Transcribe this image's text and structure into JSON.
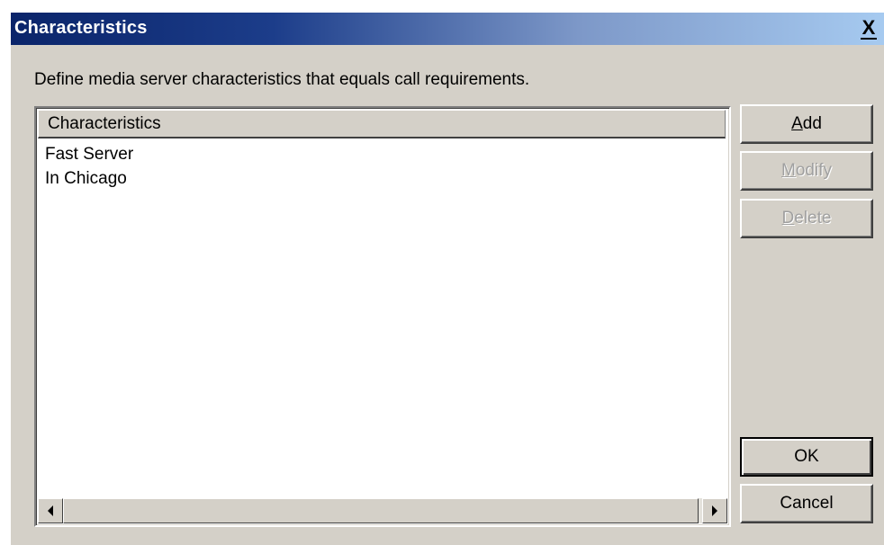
{
  "window": {
    "title": "Characteristics",
    "close_label": "X"
  },
  "description": "Define media server characteristics that equals call requirements.",
  "list": {
    "column_header": "Characteristics",
    "items": [
      "Fast Server",
      "In Chicago"
    ]
  },
  "buttons": {
    "add": {
      "accel": "A",
      "rest": "dd",
      "enabled": true
    },
    "modify": {
      "accel": "M",
      "rest": "odify",
      "enabled": false
    },
    "delete": {
      "accel": "D",
      "rest": "elete",
      "enabled": false
    },
    "ok": {
      "label": "OK",
      "default": true
    },
    "cancel": {
      "label": "Cancel"
    }
  },
  "icons": {
    "scroll_left": "scroll-left-arrow-icon",
    "scroll_right": "scroll-right-arrow-icon",
    "close": "close-icon"
  },
  "colors": {
    "title_gradient_start": "#0a246a",
    "title_gradient_end": "#a6caf0",
    "dialog_face": "#d4d0c8",
    "disabled_text": "#a0a0a0"
  }
}
